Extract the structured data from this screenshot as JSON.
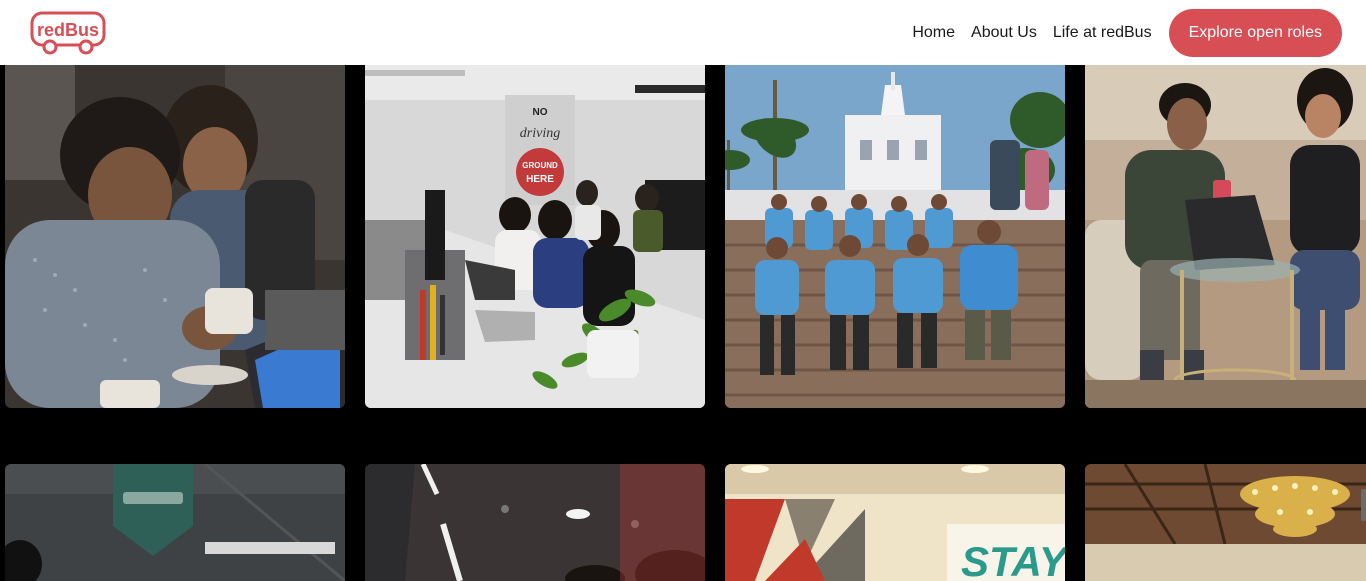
{
  "header": {
    "logo_text": "redBus",
    "nav": [
      {
        "label": "Home"
      },
      {
        "label": "About Us"
      },
      {
        "label": "Life at redBus"
      }
    ],
    "cta_label": "Explore open roles"
  },
  "gallery": {
    "photos": [
      {
        "name": "photo-colleagues-laptop"
      },
      {
        "name": "photo-office-workspace"
      },
      {
        "name": "photo-team-outing-church"
      },
      {
        "name": "photo-meeting-lounge"
      },
      {
        "name": "photo-office-banner"
      },
      {
        "name": "photo-office-ceiling"
      },
      {
        "name": "photo-stay-wall"
      },
      {
        "name": "photo-chandelier-hall"
      }
    ],
    "wall_sign_text": "NO DRIVING GROUND HERE",
    "stay_text": "STAY"
  },
  "colors": {
    "brand": "#d84e55",
    "background": "#000000",
    "header_bg": "#ffffff"
  }
}
